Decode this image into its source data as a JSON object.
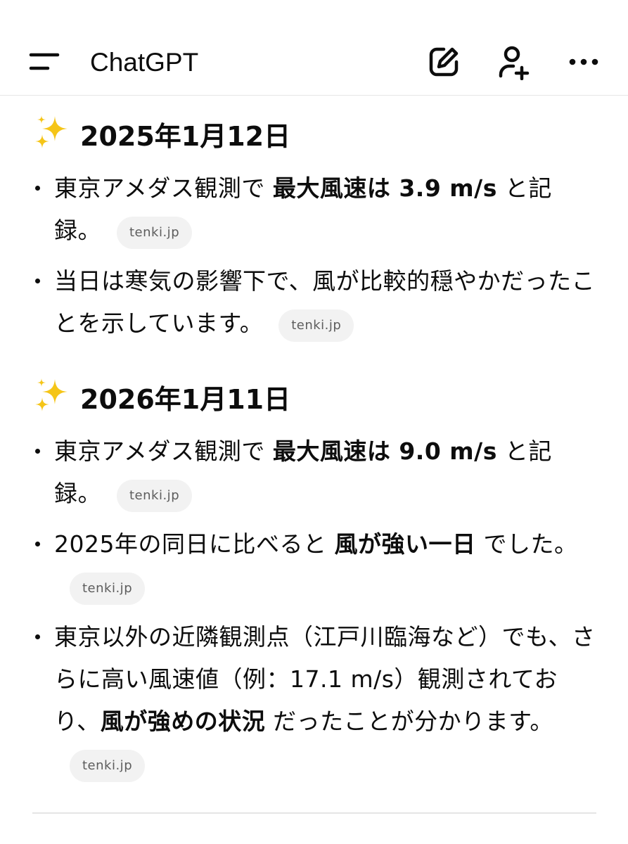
{
  "header": {
    "title": "ChatGPT",
    "icons": [
      "menu-icon",
      "edit-icon",
      "add-user-icon",
      "more-icon"
    ]
  },
  "sections": [
    {
      "heading": "2025年1月12日",
      "bullets": [
        {
          "parts": [
            {
              "t": "東京アメダス観測で "
            },
            {
              "t": "最大風速は 3.9 m/s",
              "b": true
            },
            {
              "t": " と記録。"
            }
          ],
          "source": "tenki.jp"
        },
        {
          "parts": [
            {
              "t": "当日は寒気の影響下で、風が比較的穏やかだったことを示しています。"
            }
          ],
          "source": "tenki.jp"
        }
      ]
    },
    {
      "heading": "2026年1月11日",
      "bullets": [
        {
          "parts": [
            {
              "t": "東京アメダス観測で "
            },
            {
              "t": "最大風速は 9.0 m/s",
              "b": true
            },
            {
              "t": " と記録。"
            }
          ],
          "source": "tenki.jp"
        },
        {
          "parts": [
            {
              "t": "2025年の同日に比べると "
            },
            {
              "t": "風が強い一日",
              "b": true
            },
            {
              "t": " でした。"
            }
          ],
          "source": "tenki.jp"
        },
        {
          "parts": [
            {
              "t": "東京以外の近隣観測点（江戸川臨海など）でも、さらに高い風速値（例：17.1 m/s）観測されており、"
            },
            {
              "t": "風が強めの状況",
              "b": true
            },
            {
              "t": " だったことが分かります。"
            }
          ],
          "source": "tenki.jp"
        }
      ]
    }
  ],
  "colors": {
    "text": "#0d0d0d",
    "chip_bg": "#f2f2f2",
    "chip_text": "#5d5d5d",
    "divider": "#e5e5e5"
  }
}
